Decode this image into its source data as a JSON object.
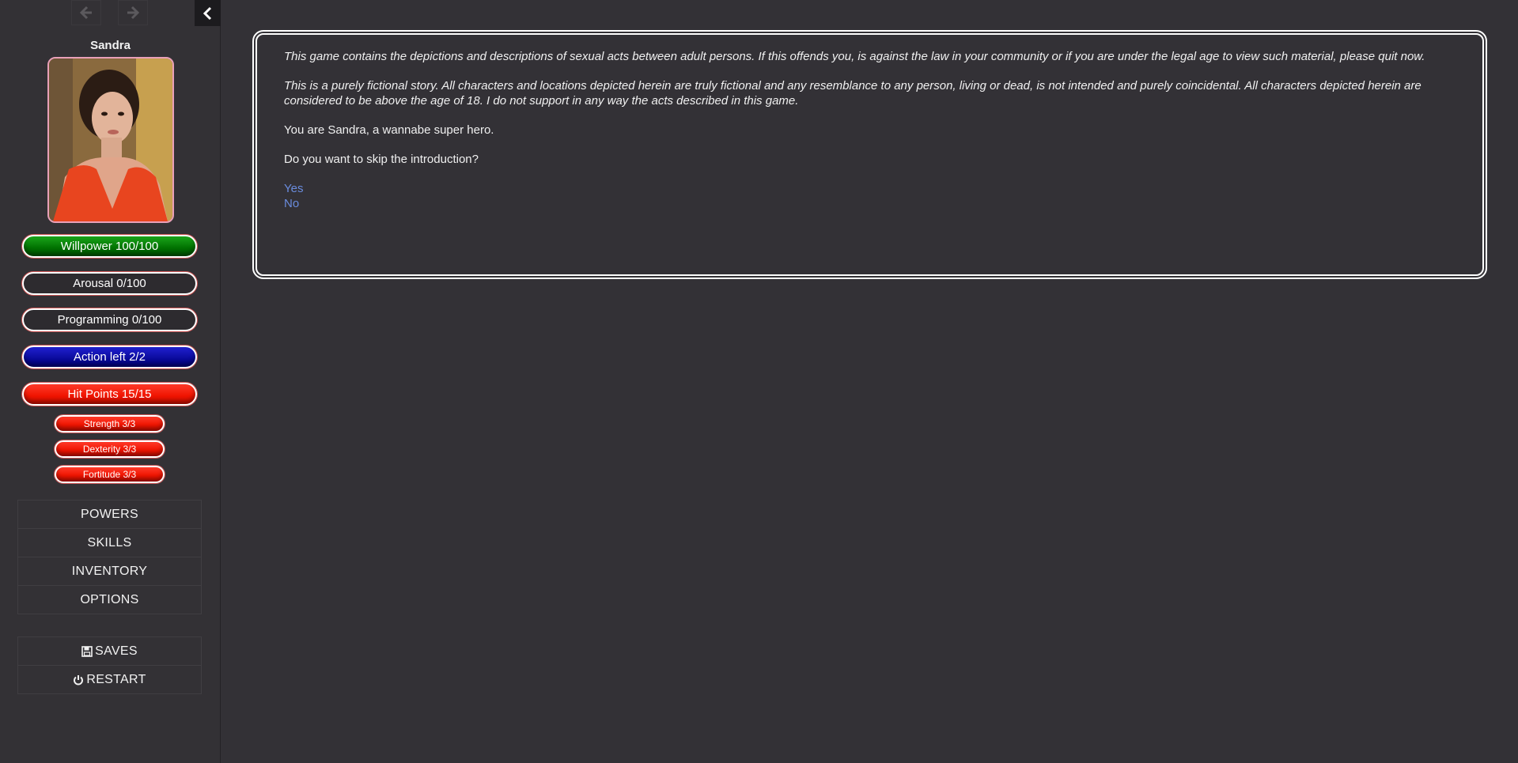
{
  "sidebar": {
    "character_name": "Sandra",
    "stats": {
      "willpower": "Willpower 100/100",
      "arousal": "Arousal 0/100",
      "programming": "Programming 0/100",
      "action": "Action left 2/2",
      "hit_points": "Hit Points 15/15",
      "strength": "Strength 3/3",
      "dexterity": "Dexterity 3/3",
      "fortitude": "Fortitude 3/3"
    },
    "menu": [
      "POWERS",
      "SKILLS",
      "INVENTORY",
      "OPTIONS"
    ],
    "system_menu": {
      "saves": "SAVES",
      "restart": "RESTART"
    }
  },
  "passage": {
    "disclaimer_1": "This game contains the depictions and descriptions of sexual acts between adult persons. If this offends you, is against the law in your community or if you are under the legal age to view such material, please quit now.",
    "disclaimer_2": "This is a purely fictional story. All characters and locations depicted herein are truly fictional and any resemblance to any person, living or dead, is not intended and purely coincidental. All characters depicted herein are considered to be above the age of 18. I do not support in any way the acts described in this game.",
    "intro": "You are Sandra, a wannabe super hero.",
    "question": "Do you want to skip the introduction?",
    "links": [
      "Yes",
      "No"
    ]
  },
  "colors": {
    "background": "#333136",
    "willpower": "#007000",
    "action": "#0a0a9a",
    "hit_points": "#f01400",
    "link": "#6a8cde"
  }
}
